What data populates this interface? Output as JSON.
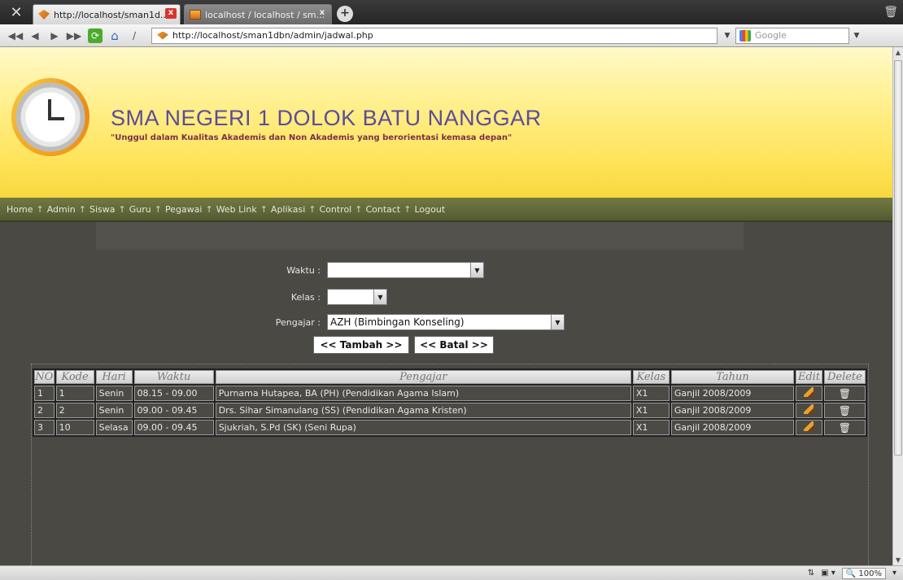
{
  "browser": {
    "tabs": [
      {
        "title": "http://localhost/sman1d...",
        "active": true
      },
      {
        "title": "localhost / localhost / sm...",
        "active": false
      }
    ],
    "url": "http://localhost/sman1dbn/admin/jadwal.php",
    "search_placeholder": "Google",
    "zoom": "100%"
  },
  "header": {
    "school_name": "SMA NEGERI 1 DOLOK BATU NANGGAR",
    "motto": "\"Unggul dalam Kualitas Akademis dan Non Akademis yang berorientasi kemasa depan\""
  },
  "menu": [
    "Home",
    "Admin",
    "Siswa",
    "Guru",
    "Pegawai",
    "Web Link",
    "Aplikasi",
    "Control",
    "Contact",
    "Logout"
  ],
  "menu_separator": "↑",
  "form": {
    "waktu_label": "Waktu :",
    "waktu_value": "",
    "kelas_label": "Kelas :",
    "kelas_value": "",
    "pengajar_label": "Pengajar :",
    "pengajar_value": "AZH (Bimbingan Konseling)",
    "tambah_button": "<< Tambah >>",
    "batal_button": "<< Batal >>"
  },
  "table": {
    "headers": [
      "NO",
      "Kode",
      "Hari",
      "Waktu",
      "Pengajar",
      "Kelas",
      "Tahun",
      "Edit",
      "Delete"
    ],
    "rows": [
      [
        "1",
        "1",
        "Senin",
        "08.15 - 09.00",
        "Purnama Hutapea, BA (PH) (Pendidikan Agama Islam)",
        "X1",
        "Ganjil 2008/2009"
      ],
      [
        "2",
        "2",
        "Senin",
        "09.00 - 09.45",
        "Drs. Sihar Simanulang (SS) (Pendidikan Agama Kristen)",
        "X1",
        "Ganjil 2008/2009"
      ],
      [
        "3",
        "10",
        "Selasa",
        "09.00 - 09.45",
        "Sjukriah, S.Pd (SK) (Seni Rupa)",
        "X1",
        "Ganjil 2008/2009"
      ]
    ]
  },
  "colors": {
    "header_yellow": "#ffe35a",
    "menu_green": "#5f6636",
    "page_bg": "#4a4944",
    "title_purple": "#5b4b9a"
  }
}
